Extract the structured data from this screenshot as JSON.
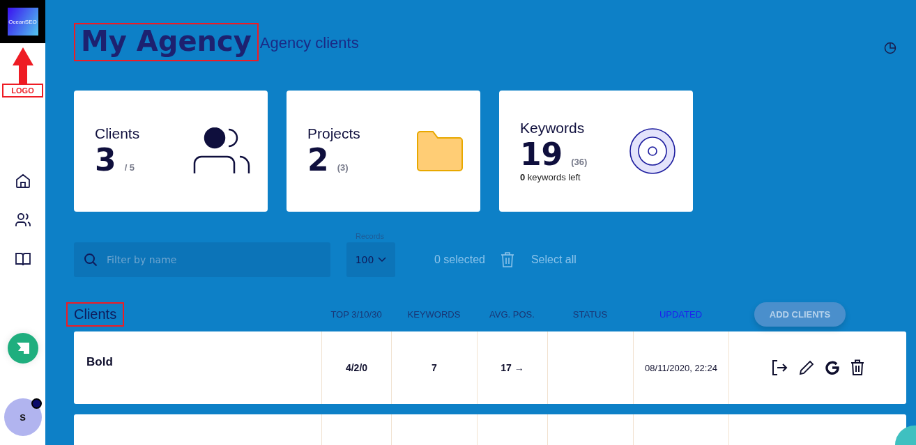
{
  "sidebar": {
    "logo_text": "OceanSEO",
    "annotation_label": "LOGO",
    "nav": [
      {
        "kind": "home",
        "selected": false
      },
      {
        "kind": "users",
        "selected": false
      },
      {
        "kind": "book",
        "selected": false
      }
    ],
    "avatar": {
      "initial": "S",
      "notification": true
    }
  },
  "header": {
    "title": "My Agency",
    "subtitle": "Agency clients"
  },
  "stats": [
    {
      "kind": "clients",
      "label": "Clients",
      "value": "3",
      "extra": "/ 5"
    },
    {
      "kind": "projects",
      "label": "Projects",
      "value": "2",
      "extra": "(3)"
    },
    {
      "kind": "keywords",
      "label": "Keywords",
      "value": "19",
      "extra": "(36)",
      "note": "**0** keywords left"
    }
  ],
  "toolbar": {
    "search": {
      "placeholder": "Filter by name"
    },
    "records": {
      "label": "Records",
      "value": "100"
    },
    "selected_count": "0 selected",
    "select_all": "Select all",
    "disabled": true
  },
  "table": {
    "title": "Clients",
    "columns": [
      {
        "label": "TOP 3/10/30",
        "sorted": false
      },
      {
        "label": "KEYWORDS",
        "sorted": false
      },
      {
        "label": "AVG. POS.",
        "sorted": false
      },
      {
        "label": "STATUS",
        "sorted": false
      },
      {
        "label": "UPDATED",
        "sorted": true
      }
    ],
    "add_button": "ADD CLIENTS",
    "rows": [
      {
        "name": "Bold",
        "top": "4/2/0",
        "keywords": "7",
        "avg_pos": "17 →",
        "status": "",
        "updated": "08/11/2020, 22:24"
      },
      {
        "name": "",
        "top": "",
        "keywords": "",
        "avg_pos": "",
        "status": "",
        "updated": ""
      }
    ]
  }
}
